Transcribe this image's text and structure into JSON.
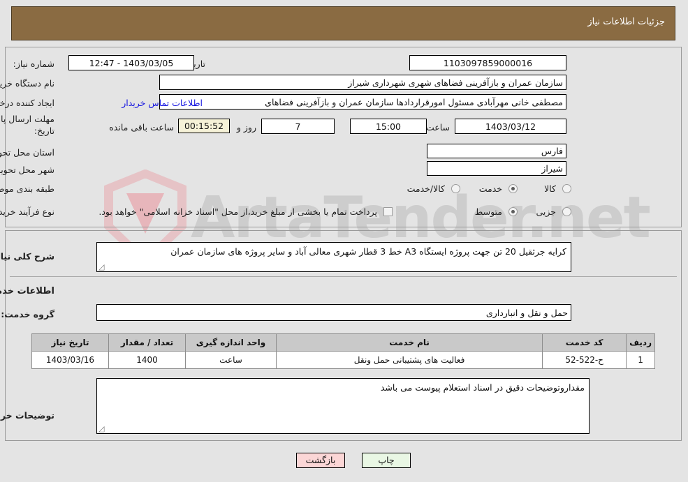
{
  "header": {
    "title": "جزئیات اطلاعات نیاز"
  },
  "top": {
    "need_number_label": "شماره نیاز:",
    "need_number_value": "1103097859000016",
    "announce_label": "تاریخ و ساعت اعلان عمومی:",
    "announce_value": "1403/03/05 - 12:47",
    "buyer_org_label": "نام دستگاه خریدار:",
    "buyer_org_value": "سازمان عمران و بازآفرینی فضاهای شهری شهرداری شیراز",
    "requester_label": "ایجاد کننده درخواست:",
    "requester_value": "مصطفی خانی مهرآبادی مسئول امورقراردادها سازمان عمران و بازآفرینی فضاهای",
    "contact_link": "اطلاعات تماس خریدار",
    "deadline_label_1": "مهلت ارسال پاسخ: تا",
    "deadline_label_2": "تاریخ:",
    "deadline_date": "1403/03/12",
    "hour_word": "ساعت",
    "deadline_time": "15:00",
    "days_left": "7",
    "days_word": "روز و",
    "countdown": "00:15:52",
    "remaining_word": "ساعت باقی مانده",
    "province_label": "استان محل تحویل:",
    "province_value": "فارس",
    "city_label": "شهر محل تحویل:",
    "city_value": "شیراز",
    "category_label": "طبقه بندی موضوعی:",
    "category_options": [
      {
        "label": "کالا",
        "selected": false
      },
      {
        "label": "خدمت",
        "selected": true
      },
      {
        "label": "کالا/خدمت",
        "selected": false
      }
    ],
    "process_label": "نوع فرآیند خرید :",
    "process_options": [
      {
        "label": "جزیی",
        "selected": false
      },
      {
        "label": "متوسط",
        "selected": true
      }
    ],
    "treasury_checkbox_label": "پرداخت تمام یا بخشی از مبلغ خرید،از محل \"اسناد خزانه اسلامی\" خواهد بود.",
    "treasury_checked": false
  },
  "mid": {
    "summary_label": "شرح کلی نیاز:",
    "summary_value": "کرایه جرثقیل 20 تن جهت پروژه ایستگاه A3 خط 3 قطار شهری معالی آباد و سایر پروژه های سازمان عمران",
    "services_heading": "اطلاعات خدمات مورد نیاز",
    "service_group_label": "گروه خدمت:",
    "service_group_value": "حمل و نقل و انبارداری",
    "table": {
      "headers": [
        "ردیف",
        "کد خدمت",
        "نام خدمت",
        "واحد اندازه گیری",
        "تعداد / مقدار",
        "تاریخ نیاز"
      ],
      "rows": [
        [
          "1",
          "ح-522-52",
          "فعالیت های پشتیبانی حمل ونقل",
          "ساعت",
          "1400",
          "1403/03/16"
        ]
      ]
    },
    "buyer_notes_label": "توضیحات خریدار:",
    "buyer_notes_value": "مقداروتوضیحات دقیق در اسناد استعلام پیوست می باشد"
  },
  "footer": {
    "print_label": "چاپ",
    "back_label": "بازگشت"
  },
  "watermark": {
    "text": "ArtaTender.net"
  },
  "colors": {
    "header_bg": "#8a6b42",
    "link": "#1414e0",
    "print_btn": "#e9f7e4",
    "back_btn": "#fbd6d6",
    "countdown_bg": "#f6f2d8",
    "table_header_bg": "#c9c9c9"
  }
}
